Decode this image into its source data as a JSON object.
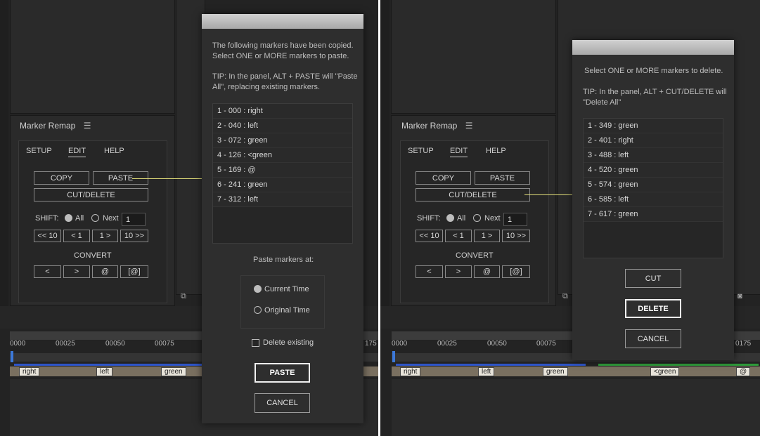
{
  "left": {
    "panel_title": "Marker Remap",
    "tabs": [
      "SETUP",
      "EDIT",
      "HELP"
    ],
    "active_tab": "EDIT",
    "buttons": {
      "copy": "COPY",
      "paste": "PASTE",
      "cut_delete": "CUT/DELETE"
    },
    "shift": {
      "label": "SHIFT:",
      "opt_all": "All",
      "opt_next": "Next",
      "value": "1"
    },
    "shift_buttons": [
      "<< 10",
      "< 1",
      "1 >",
      "10 >>"
    ],
    "convert": {
      "label": "CONVERT",
      "buttons": [
        "<",
        ">",
        "@",
        "[@]"
      ]
    },
    "timeline": {
      "ticks": [
        "0000",
        "00025",
        "00050",
        "00075",
        "175"
      ],
      "markers": [
        "right",
        "left",
        "green"
      ]
    },
    "dialog": {
      "intro": "The following markers have been copied. Select ONE or MORE markers to paste.",
      "tip": "TIP: In the panel, ALT + PASTE will \"Paste All\", replacing existing markers.",
      "items": [
        "1 - 000 : right",
        "2 - 040 : left",
        "3 - 072 : green",
        "4 - 126 : <green",
        "5 - 169 : @",
        "6 - 241 : green",
        "7 - 312 : left"
      ],
      "paste_at_label": "Paste markers at:",
      "opt_current": "Current Time",
      "opt_original": "Original Time",
      "delete_existing": "Delete existing",
      "paste_button": "PASTE",
      "cancel_button": "CANCEL"
    }
  },
  "right": {
    "panel_title": "Marker Remap",
    "tabs": [
      "SETUP",
      "EDIT",
      "HELP"
    ],
    "active_tab": "EDIT",
    "buttons": {
      "copy": "COPY",
      "paste": "PASTE",
      "cut_delete": "CUT/DELETE"
    },
    "shift": {
      "label": "SHIFT:",
      "opt_all": "All",
      "opt_next": "Next",
      "value": "1"
    },
    "shift_buttons": [
      "<< 10",
      "< 1",
      "1 >",
      "10 >>"
    ],
    "convert": {
      "label": "CONVERT",
      "buttons": [
        "<",
        ">",
        "@",
        "[@]"
      ]
    },
    "timeline": {
      "ticks": [
        "0000",
        "00025",
        "00050",
        "00075",
        "0175"
      ],
      "markers": [
        "right",
        "left",
        "green",
        "<green",
        "@"
      ]
    },
    "dialog": {
      "intro": "Select ONE or MORE markers to delete.",
      "tip": "TIP: In the panel, ALT + CUT/DELETE will \"Delete All\"",
      "items": [
        "1 - 349 : green",
        "2 - 401 : right",
        "3 - 488 : left",
        "4 - 520 : green",
        "5 - 574 : green",
        "6 - 585 : left",
        "7 - 617 : green"
      ],
      "cut_button": "CUT",
      "delete_button": "DELETE",
      "cancel_button": "CANCEL"
    }
  },
  "colors": {
    "connector": "#e4e07a",
    "blue_track": "#2f55c8",
    "green_track": "#2f9a3a"
  }
}
